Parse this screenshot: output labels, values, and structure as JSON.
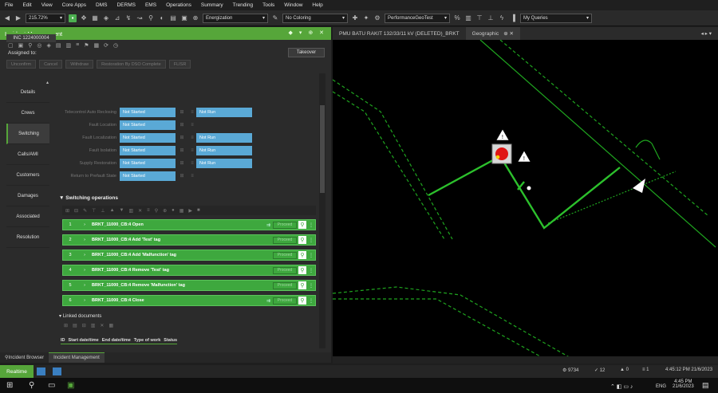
{
  "menu": [
    "File",
    "Edit",
    "View",
    "Core Apps",
    "DMS",
    "DERMS",
    "EMS",
    "Operations",
    "Summary",
    "Trending",
    "Tools",
    "Window",
    "Help"
  ],
  "toolbar": {
    "zoom": "215.72%",
    "energization": "Energization",
    "coloring": "No Coloring",
    "perf": "PerformanceGeoTest",
    "queries": "My Queries"
  },
  "panel": {
    "title": "Incident Management",
    "controls": "◆ ▾ ⊕ ✕",
    "incident_tab": "INC 1224000004",
    "assigned_label": "Assigned to:",
    "takeover": "Takeover",
    "actions": [
      "Unconfirm",
      "Cancel",
      "Withdraw",
      "Restoration By DSO Complete",
      "FLISR"
    ],
    "side": [
      "Details",
      "Crews",
      "Switching",
      "Calls/AMI",
      "Customers",
      "Damages",
      "Associated",
      "Resolution"
    ],
    "status_rows": [
      {
        "label": "Telecontrol Auto Reclosing",
        "status": "Not Started",
        "extra": "Not Run"
      },
      {
        "label": "Fault Location",
        "status": "Not Started",
        "extra": ""
      },
      {
        "label": "Fault Localization",
        "status": "Not Started",
        "extra": "Not Run"
      },
      {
        "label": "Fault Isolation",
        "status": "Not Started",
        "extra": "Not Run"
      },
      {
        "label": "Supply Restoration",
        "status": "Not Started",
        "extra": "Not Run"
      },
      {
        "label": "Return to Prefault State",
        "status": "Not Started",
        "extra": ""
      }
    ],
    "switching_header": "Switching operations",
    "operations": [
      {
        "num": "1",
        "text": "BRKT_11000_CB:4  Open",
        "proceed": "Proceed"
      },
      {
        "num": "2",
        "text": "BRKT_11000_CB:4  Add 'Test' tag",
        "proceed": "Proceed"
      },
      {
        "num": "3",
        "text": "BRKT_11000_CB:4  Add 'Malfunction' tag",
        "proceed": "Proceed"
      },
      {
        "num": "4",
        "text": "BRKT_11000_CB:4  Remove 'Test' tag",
        "proceed": "Proceed"
      },
      {
        "num": "5",
        "text": "BRKT_11000_CB:4  Remove 'Malfunction' tag",
        "proceed": "Proceed"
      },
      {
        "num": "6",
        "text": "BRKT_11000_CB:4  Close",
        "proceed": "Proceed"
      }
    ],
    "linked_header": "Linked documents",
    "linked_columns": [
      "ID",
      "Start date/time",
      "End date/time",
      "Type of work",
      "Status"
    ]
  },
  "bottom_tabs": [
    "Incident Browser",
    "Incident Management"
  ],
  "map": {
    "tab_title": "PMU BATU RAKIT 132/33/11 kV (DELETED)_BRKT",
    "geo_tab": "Geographic"
  },
  "status": {
    "realtime": "Realtime",
    "count1": "9734",
    "count2": "12",
    "count3": "0",
    "count4": "1",
    "clock": "4:45:12 PM 21/6/2023"
  },
  "taskbar": {
    "lang": "ENG",
    "time": "4:45 PM",
    "date": "21/6/2023"
  },
  "colors": {
    "accent": "#56a63a",
    "status_blue": "#5aa9d6",
    "line_green": "#1fa51f"
  }
}
